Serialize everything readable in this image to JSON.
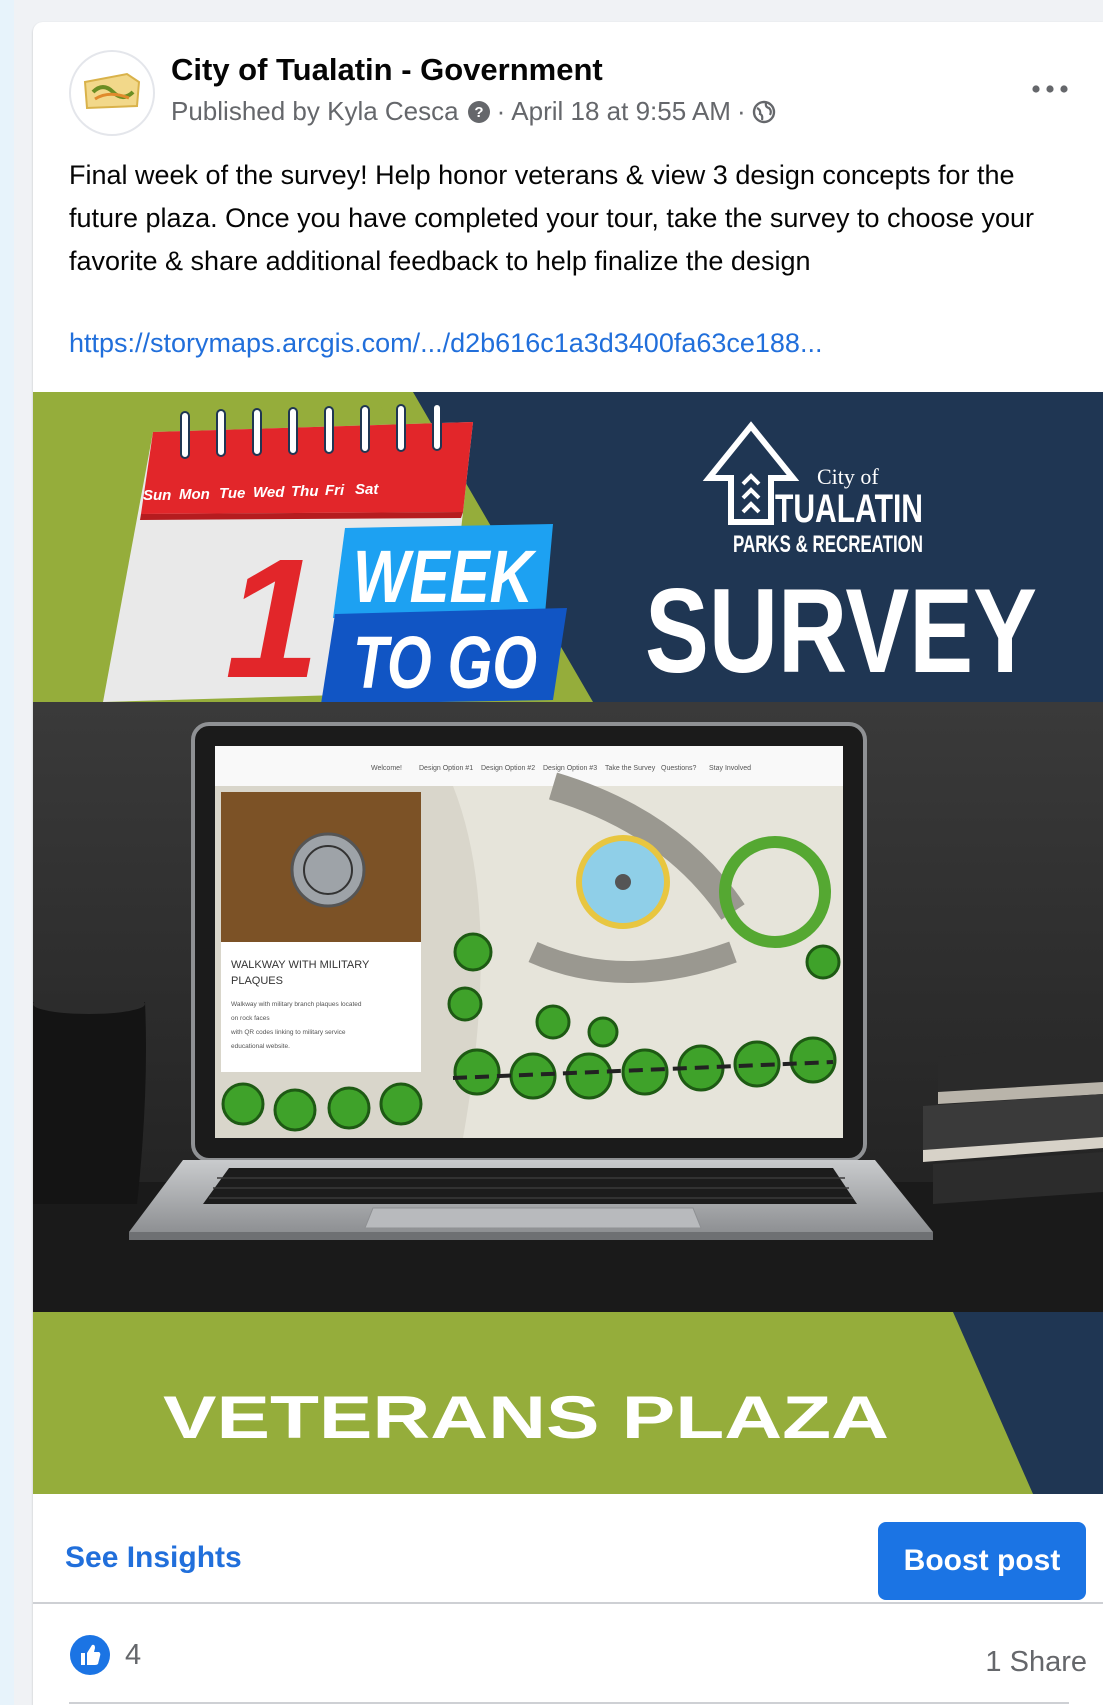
{
  "post": {
    "page_name": "City of Tualatin - Government",
    "published_by": "Published by Kyla Cesca",
    "date": "April 18 at 9:55 AM",
    "body": "Final week of the survey! Help honor veterans & view 3 design concepts for the future plaza. Once you have completed your tour, take the survey to choose your favorite & share additional feedback to help finalize the design",
    "link": "https://storymaps.arcgis.com/.../d2b616c1a3d3400fa63ce188..."
  },
  "image": {
    "days": [
      "Sun",
      "Mon",
      "Tue",
      "Wed",
      "Thu",
      "Fri",
      "Sat"
    ],
    "count": "1",
    "week": "WEEK",
    "to_go": "TO GO",
    "city_of": "City of",
    "tualatin": "TUALATIN",
    "parks": "PARKS & RECREATION",
    "survey": "SURVEY",
    "nav_items": [
      "Welcome!",
      "Design Option #1",
      "Design Option #2",
      "Design Option #3",
      "Take the Survey",
      "Questions?",
      "Stay Involved"
    ],
    "panel_title_1": "WALKWAY WITH MILITARY",
    "panel_title_2": "PLAQUES",
    "panel_text_1": "Walkway with military branch plaques located",
    "panel_text_2": "on rock faces",
    "panel_text_3": "with QR codes linking to military service",
    "panel_text_4": "educational website.",
    "plaza": "VETERANS PLAZA"
  },
  "actions": {
    "see_insights": "See Insights",
    "boost_post": "Boost post"
  },
  "engagement": {
    "reaction_count": "4",
    "shares": "1 Share"
  },
  "colors": {
    "link": "#216fdb",
    "boost": "#1b74e4",
    "navy": "#1f3653",
    "green": "#95ad3b"
  }
}
